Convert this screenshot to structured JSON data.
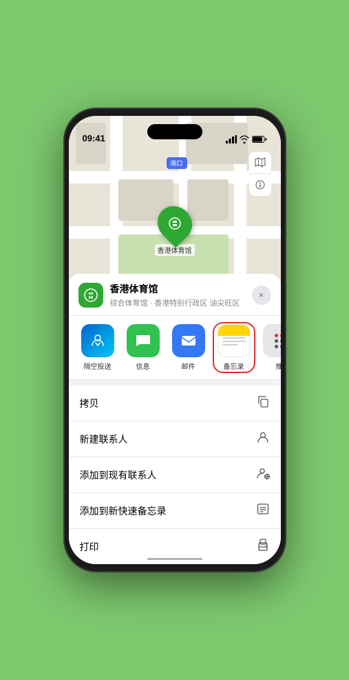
{
  "phone": {
    "time": "09:41",
    "status_icons": "●●● ▲ ■"
  },
  "map": {
    "location_label": "南口",
    "venue_label": "香港体育馆"
  },
  "sheet": {
    "venue_name": "香港体育馆",
    "venue_subtitle": "综合体育馆 · 香港特别行政区 油尖旺区",
    "close_label": "×"
  },
  "share_items": [
    {
      "id": "airdrop",
      "label": "隔空投送",
      "type": "airdrop"
    },
    {
      "id": "message",
      "label": "信息",
      "type": "message"
    },
    {
      "id": "mail",
      "label": "邮件",
      "type": "mail"
    },
    {
      "id": "notes",
      "label": "备忘录",
      "type": "notes"
    },
    {
      "id": "more",
      "label": "推",
      "type": "more"
    }
  ],
  "actions": [
    {
      "id": "copy",
      "label": "拷贝",
      "icon": "📋"
    },
    {
      "id": "new-contact",
      "label": "新建联系人",
      "icon": "👤"
    },
    {
      "id": "add-contact",
      "label": "添加到现有联系人",
      "icon": "👤"
    },
    {
      "id": "add-note",
      "label": "添加到新快速备忘录",
      "icon": "📝"
    },
    {
      "id": "print",
      "label": "打印",
      "icon": "🖨"
    }
  ],
  "colors": {
    "green": "#2ea832",
    "blue": "#3478f6",
    "airdrop_start": "#0066cc",
    "airdrop_end": "#00c6f8",
    "highlight_red": "#e03030"
  }
}
